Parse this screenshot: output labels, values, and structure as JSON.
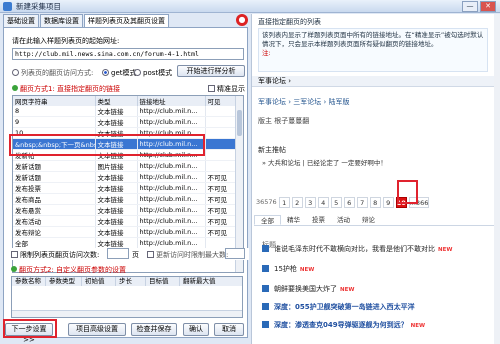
{
  "window": {
    "title": "新建采集项目",
    "minimize": "—",
    "close": "✕"
  },
  "tabs": [
    "基础设置",
    "数据库设置",
    "样题列表页及其翻页设置"
  ],
  "url_section": {
    "label": "请在此输入样题列表页的起始网址:",
    "url": "http://club.mil.news.sina.com.cn/forum-4-1.html",
    "access_label": "列表页的翻页访问方式:",
    "get_label": "get模式",
    "post_label": "post模式",
    "start_button": "开始进行样分析"
  },
  "method1": {
    "label": "翻页方式1: 直接指定翻页的链接",
    "precise_label": "精准显示"
  },
  "grid": {
    "headers": [
      "网页字符串",
      "类型",
      "链接地址",
      "可见"
    ],
    "rows": [
      [
        "8",
        "文本链接",
        "http://club.mil.n...",
        ""
      ],
      [
        "9",
        "文本链接",
        "http://club.mil.n...",
        ""
      ],
      [
        "10",
        "文本链接",
        "http://club.mil.n...",
        ""
      ],
      [
        "&nbsp;&nbsp;下一页&nbsp;&nbsp;",
        "文本链接",
        "http://club.mil.n...",
        ""
      ],
      [
        "发新帖",
        "文本链接",
        "http://club.mil.n...",
        ""
      ],
      [
        "发新话题",
        "图片链接",
        "http://club.mil.n...",
        ""
      ],
      [
        "发新话题",
        "文本链接",
        "http://club.mil.n...",
        "不可见"
      ],
      [
        "发布投票",
        "文本链接",
        "http://club.mil.n...",
        "不可见"
      ],
      [
        "发布商品",
        "文本链接",
        "http://club.mil.n...",
        "不可见"
      ],
      [
        "发布悬赏",
        "文本链接",
        "http://club.mil.n...",
        "不可见"
      ],
      [
        "发布活动",
        "文本链接",
        "http://club.mil.n...",
        "不可见"
      ],
      [
        "发布辩论",
        "文本链接",
        "http://club.mil.n...",
        "不可见"
      ],
      [
        "全部",
        "文本链接",
        "http://club.mil.n...",
        ""
      ]
    ],
    "selected_row": 3
  },
  "page_limit": {
    "label": "限制列表页翻页访问次数:",
    "unit": "页",
    "update_label": "更新访问时限制最大数:"
  },
  "method2": {
    "label": "翻页方式2: 自定义翻页参数的设置",
    "headers": [
      "参数名称",
      "参数类型",
      "初始值",
      "步长",
      "目标值",
      "翻新最大值"
    ]
  },
  "footer": {
    "next": "下一步设置>>",
    "advanced": "项目高级设置",
    "check_save": "检查并保存",
    "confirm": "确认",
    "cancel": "取消"
  },
  "right": {
    "title": "直接指定翻页的列表",
    "info": "该列表内显示了样题列表页面中所有的链接地址。在“精准显示”被勾选时默认情况下，只会显示本样题列表页面所有疑似翻页的链接地址。",
    "tip": "注:",
    "forum_nav": "军事论坛 ›",
    "crumb": "军事论坛 › 三军论坛 › 陆军版",
    "moderator": "版主 根子蔓蔓翻",
    "new_post": "新主推帖",
    "topic": "» 大兵和论坛 | 已经论定了 一定要好啊中！",
    "pager": [
      "36576",
      "1",
      "2",
      "3",
      "4",
      "5",
      "6",
      "7",
      "8",
      "9",
      "10",
      "...366"
    ],
    "current_page": "10",
    "subtabs": [
      "全部",
      "精华",
      "投票",
      "活动",
      "辩论"
    ],
    "col_head": "标题",
    "threads": [
      {
        "text": "谁说毛泽东时代不敢横向对比，我看是他们不敢对比",
        "new": "NEW"
      },
      {
        "text": "15护枪",
        "new": "NEW"
      },
      {
        "text": "朝鲜要换美国大炸了",
        "new": "NEW"
      },
      {
        "text": "深度：055护卫舰突破第一岛链进入西太平洋",
        "new": ""
      },
      {
        "text": "深度：渗透查克049导弹驱逐舰为何到远？",
        "new": "NEW"
      }
    ]
  }
}
